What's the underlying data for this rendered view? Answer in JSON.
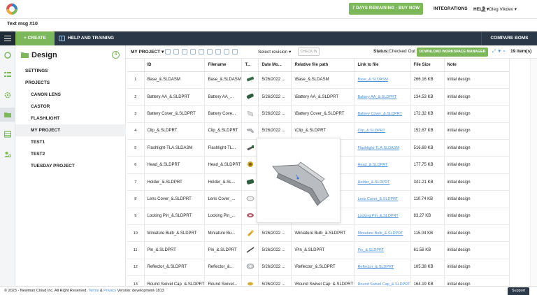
{
  "app": {
    "trial_label": "7 DAYS REMAINING - BUY NOW",
    "integrations": "INTEGRATIONS",
    "help": "HELP",
    "user_name": "Oleg Vikdev"
  },
  "subtitle": "Text msg #10",
  "navbar": {
    "create": "+ CREATE",
    "help_training": "HELP AND TRAINING",
    "compare_boms": "COMPARE BOMS"
  },
  "panel": {
    "title": "Design",
    "badge": "4",
    "settings": "SETTINGS",
    "projects": "PROJECTS",
    "project_items": [
      "CANON LENS",
      "CASTOR",
      "FLASHLIGHT",
      "MY PROJECT",
      "TEST1",
      "TEST2",
      "TUESDAY PROJECT"
    ]
  },
  "toolbar": {
    "project": "MY PROJECT",
    "select_revision": "Select revision",
    "check_in": "CHECK IN",
    "status_label": "Status:",
    "status_value": "Checked Out",
    "download": "DOWNLOAD WORKSPACE MANAGER",
    "item_count": "19 item(s)"
  },
  "table": {
    "headers": [
      "",
      "ID",
      "Filename",
      "T...",
      "Date Mo...",
      "Relative file path",
      "Link to file",
      "File Size",
      "Note"
    ],
    "rows": [
      {
        "n": "1",
        "id": "Base_&.SLDASM",
        "fn": "Base_&.SLDASM",
        "date": "5/26/2022 ...",
        "path": "\\Base_&.SLDASM",
        "link": "Base_&.SLDASM",
        "size": "266.16 KB",
        "note": "initial design",
        "thumb": "base"
      },
      {
        "n": "2",
        "id": "Battery AA_&.SLDPRT",
        "fn": "Battery AA_...",
        "date": "5/26/2022 ...",
        "path": "\\Battery AA_&.SLDPRT",
        "link": "Battery AA_&.SLDPRT",
        "size": "134.53 KB",
        "note": "initial design",
        "thumb": "battery"
      },
      {
        "n": "3",
        "id": "Battery Cover_&.SLDPRT",
        "fn": "Battery Cove...",
        "date": "5/26/2022 ...",
        "path": "\\Battery Cover_&.SLDPRT",
        "link": "Battery Cover_&.SLDPRT",
        "size": "172.32 KB",
        "note": "initial design",
        "thumb": "cover"
      },
      {
        "n": "4",
        "id": "Clip_&.SLDPRT",
        "fn": "Clip_&.SLDPRT",
        "date": "5/26/2022 ...",
        "path": "\\Clip_&.SLDPRT",
        "link": "Clip_&.SLDPRT",
        "size": "152.67 KB",
        "note": "initial design",
        "thumb": "clip"
      },
      {
        "n": "5",
        "id": "Flashlight-TLA.SLDASM",
        "fn": "Flashlight-TL...",
        "date": "",
        "path": "",
        "link": "Flashlight-TLA.SLDASM",
        "size": "516.69 KB",
        "note": "initial design",
        "thumb": "flash"
      },
      {
        "n": "6",
        "id": "Head_&.SLDPRT",
        "fn": "Head_&.SLDPRT",
        "date": "",
        "path": "",
        "link": "Head_&.SLDPRT",
        "size": "177.75 KB",
        "note": "initial design",
        "thumb": "head"
      },
      {
        "n": "7",
        "id": "Holder_&.SLDPRT",
        "fn": "Holder_&.SL...",
        "date": "",
        "path": "",
        "link": "Holder_&.SLDPRT",
        "size": "341.21 KB",
        "note": "initial design",
        "thumb": "holder"
      },
      {
        "n": "8",
        "id": "Lens Cover_&.SLDPRT",
        "fn": "Lens Cover_...",
        "date": "",
        "path": "",
        "link": "Lens Cover_&.SLDPRT",
        "size": "110.74 KB",
        "note": "initial design",
        "thumb": "lens"
      },
      {
        "n": "9",
        "id": "Locking Pin_&.SLDPRT",
        "fn": "Locking Pin_...",
        "date": "",
        "path": "",
        "link": "Locking Pin_&.SLDPRT",
        "size": "83.27 KB",
        "note": "initial design",
        "thumb": "pin"
      },
      {
        "n": "10",
        "id": "Miniature Bulb_&.SLDPRT",
        "fn": "Miniature Bu...",
        "date": "5/26/2022 ...",
        "path": "\\Miniature Bulb_&.SLDPRT",
        "link": "Miniature Bulb_&.SLDPRT",
        "size": "115.04 KB",
        "note": "initial design",
        "thumb": "bulb"
      },
      {
        "n": "11",
        "id": "Pin_&.SLDPRT",
        "fn": "Pin_&.SLDPRT",
        "date": "5/26/2022 ...",
        "path": "\\Pin_&.SLDPRT",
        "link": "Pin_&.SLDPRT",
        "size": "61.58 KB",
        "note": "initial design",
        "thumb": "pin2"
      },
      {
        "n": "12",
        "id": "Reflector_&.SLDPRT",
        "fn": "Reflector_&...",
        "date": "5/26/2022 ...",
        "path": "\\Reflector_&.SLDPRT",
        "link": "Reflector_&.SLDPRT",
        "size": "105.38 KB",
        "note": "initial design",
        "thumb": "reflector"
      },
      {
        "n": "13",
        "id": "Round Swivel Cap_&.SLDPRT",
        "fn": "Round Swivel...",
        "date": "5/26/2022 ...",
        "path": "\\Round Swivel Cap_&.SLDPRT",
        "link": "Round Swivel Cap_&.SLDPRT",
        "size": "164.19 KB",
        "note": "initial design",
        "thumb": "cap"
      }
    ]
  },
  "footer": {
    "copyright": "© 2023 - Newman Cloud Inc. All Right Reserved.",
    "terms": "Terms",
    "amp": "&",
    "privacy": "Privacy",
    "version": "Version: development-1813",
    "support": "Support"
  },
  "colors": {
    "accent_green": "#7cb75a",
    "navbar_dark": "#2a3848",
    "link_blue": "#4a90d9"
  }
}
